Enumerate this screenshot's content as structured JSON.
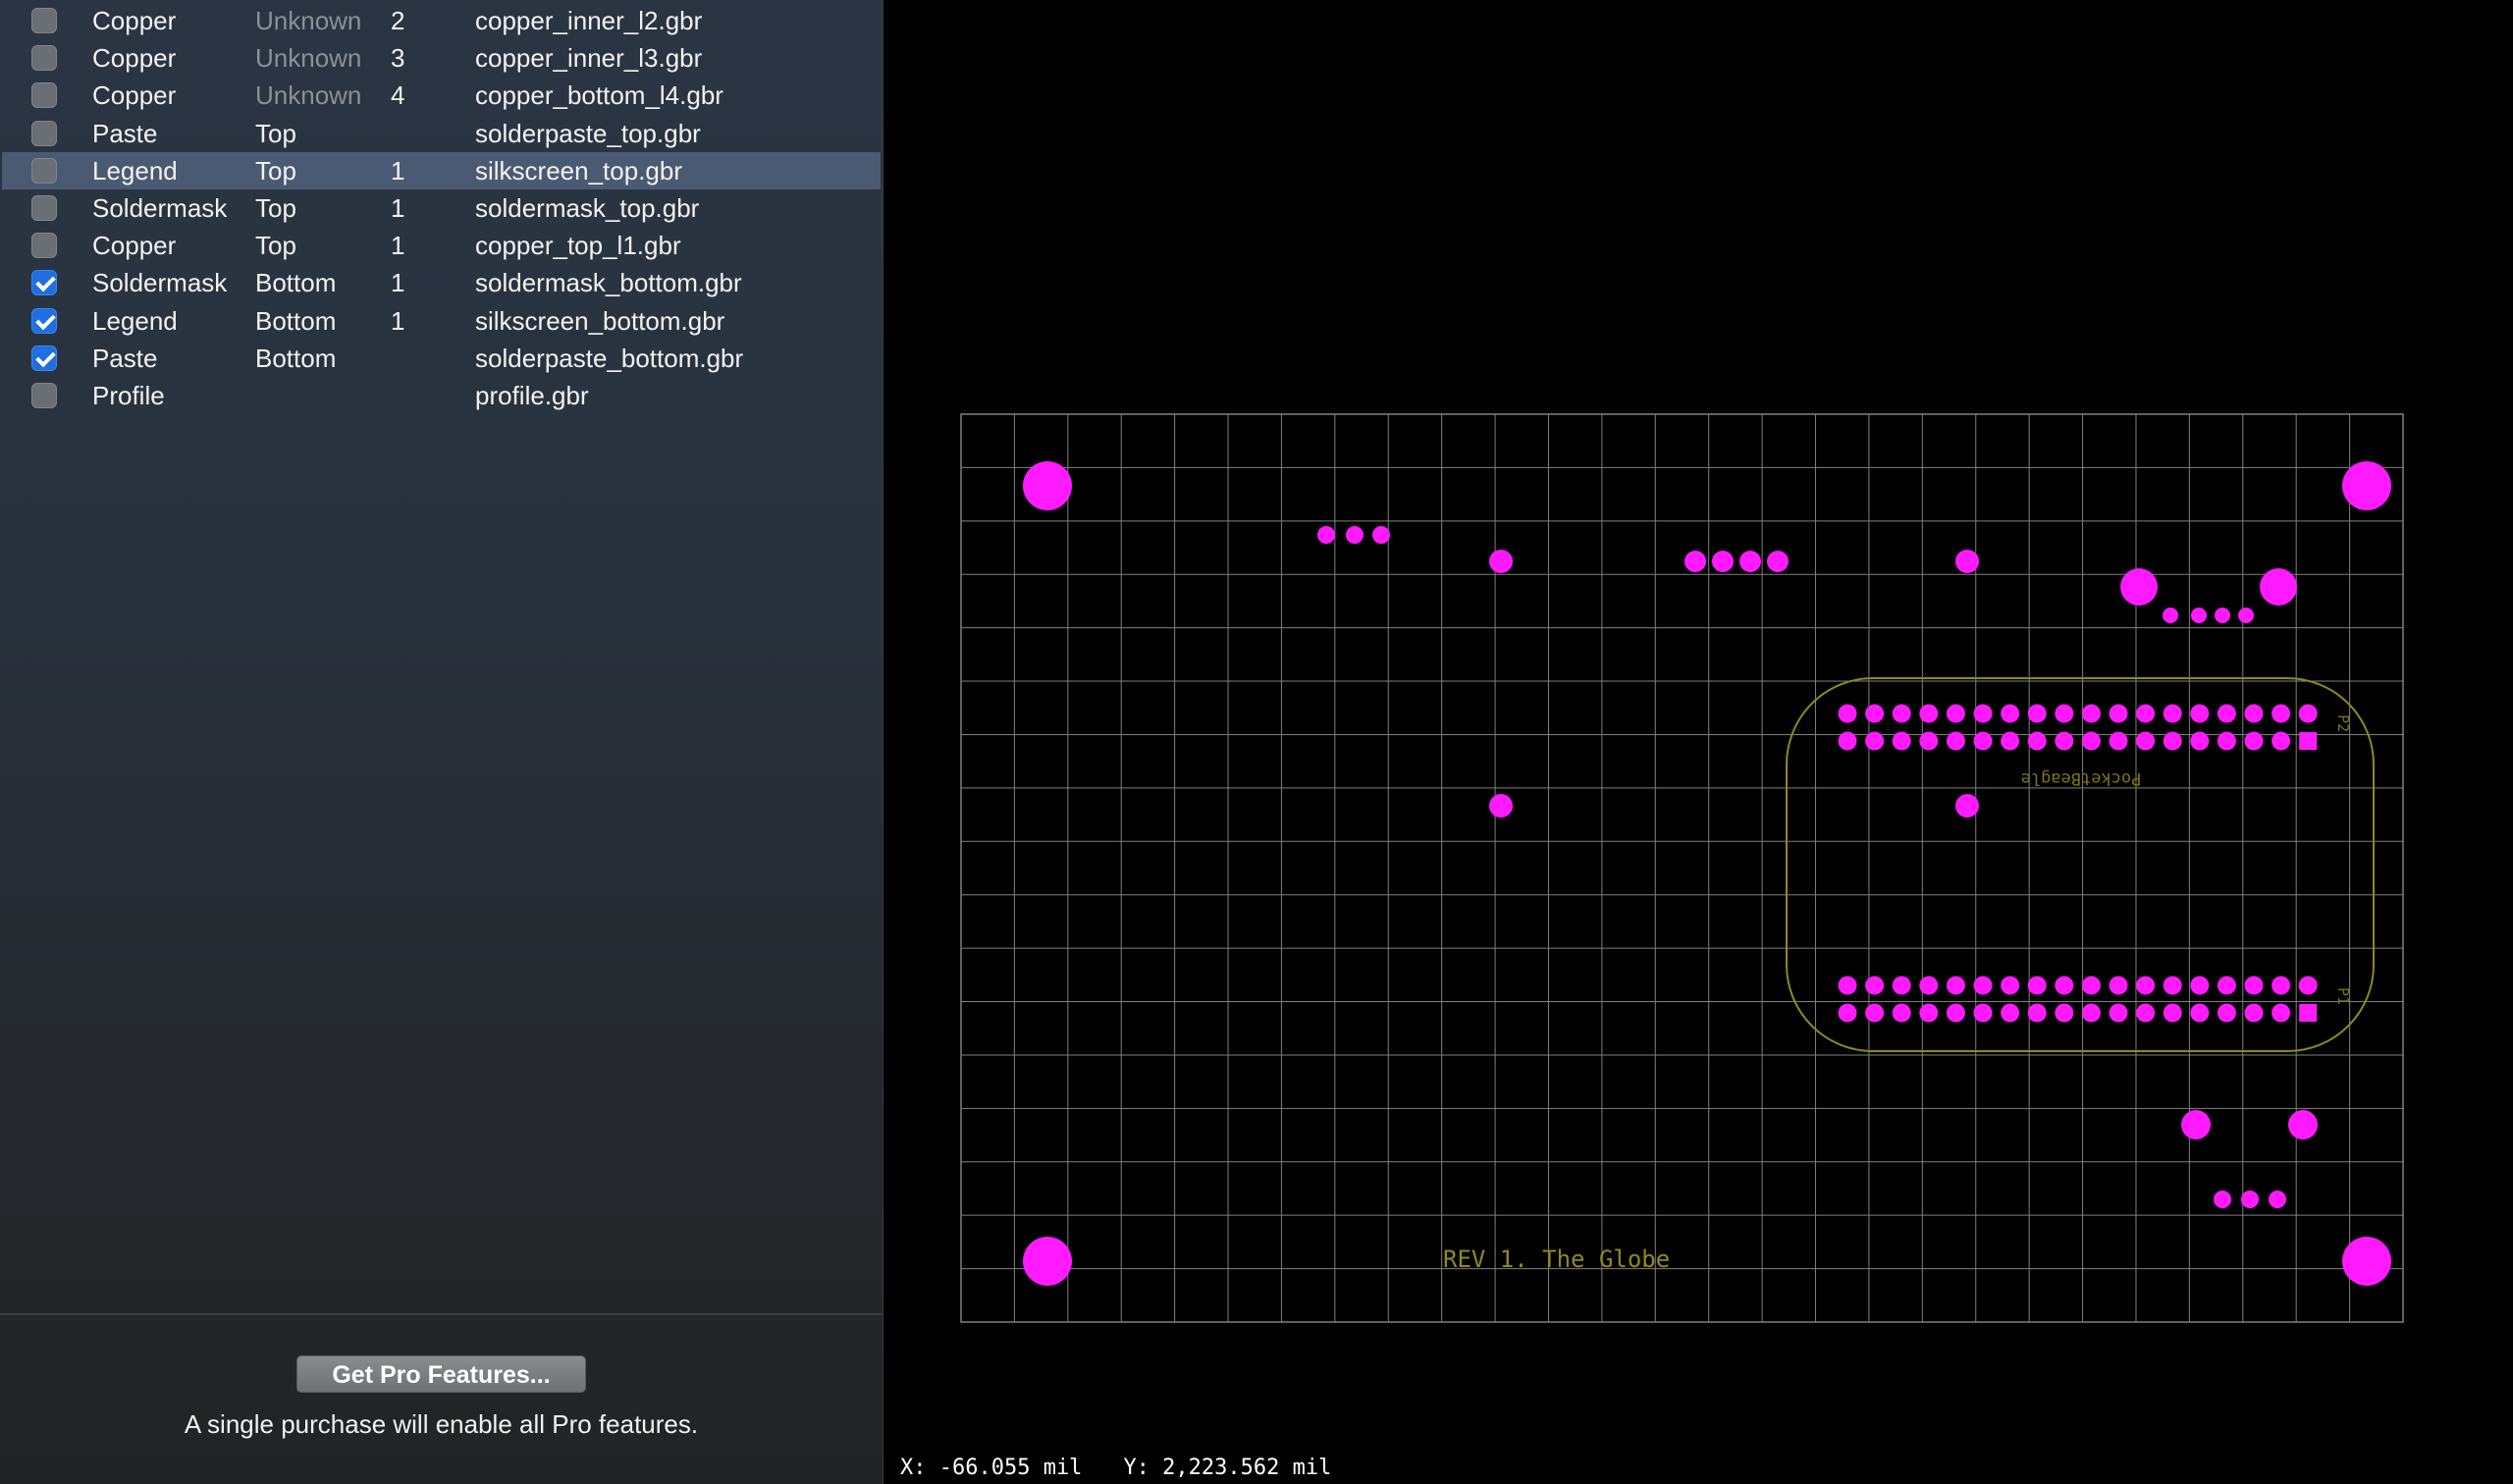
{
  "layers": [
    {
      "checked": false,
      "type": "Copper",
      "side": "Unknown",
      "side_muted": true,
      "order": "2",
      "file": "copper_inner_l2.gbr"
    },
    {
      "checked": false,
      "type": "Copper",
      "side": "Unknown",
      "side_muted": true,
      "order": "3",
      "file": "copper_inner_l3.gbr"
    },
    {
      "checked": false,
      "type": "Copper",
      "side": "Unknown",
      "side_muted": true,
      "order": "4",
      "file": "copper_bottom_l4.gbr"
    },
    {
      "checked": false,
      "type": "Paste",
      "side": "Top",
      "side_muted": false,
      "order": "",
      "file": "solderpaste_top.gbr"
    },
    {
      "checked": false,
      "type": "Legend",
      "side": "Top",
      "side_muted": false,
      "order": "1",
      "file": "silkscreen_top.gbr",
      "selected": true
    },
    {
      "checked": false,
      "type": "Soldermask",
      "side": "Top",
      "side_muted": false,
      "order": "1",
      "file": "soldermask_top.gbr"
    },
    {
      "checked": false,
      "type": "Copper",
      "side": "Top",
      "side_muted": false,
      "order": "1",
      "file": "copper_top_l1.gbr"
    },
    {
      "checked": true,
      "type": "Soldermask",
      "side": "Bottom",
      "side_muted": false,
      "order": "1",
      "file": "soldermask_bottom.gbr"
    },
    {
      "checked": true,
      "type": "Legend",
      "side": "Bottom",
      "side_muted": false,
      "order": "1",
      "file": "silkscreen_bottom.gbr"
    },
    {
      "checked": true,
      "type": "Paste",
      "side": "Bottom",
      "side_muted": false,
      "order": "",
      "file": "solderpaste_bottom.gbr"
    },
    {
      "checked": false,
      "type": "Profile",
      "side": "",
      "side_muted": false,
      "order": "",
      "file": "profile.gbr"
    }
  ],
  "pro": {
    "button_label": "Get Pro Features...",
    "note": "A single purchase will enable all Pro features."
  },
  "status": {
    "x": "X: -66.055 mil",
    "y": "Y: 2,223.562 mil"
  },
  "board": {
    "silk_text": "REV 1. The Globe",
    "silk_text_mirrored": "PocketBeagle",
    "header_label_top": "P2",
    "header_label_bottom": "P1",
    "colors": {
      "pad": "#ff1aff",
      "silk": "#8e8a1e",
      "grid": "#808080"
    }
  }
}
